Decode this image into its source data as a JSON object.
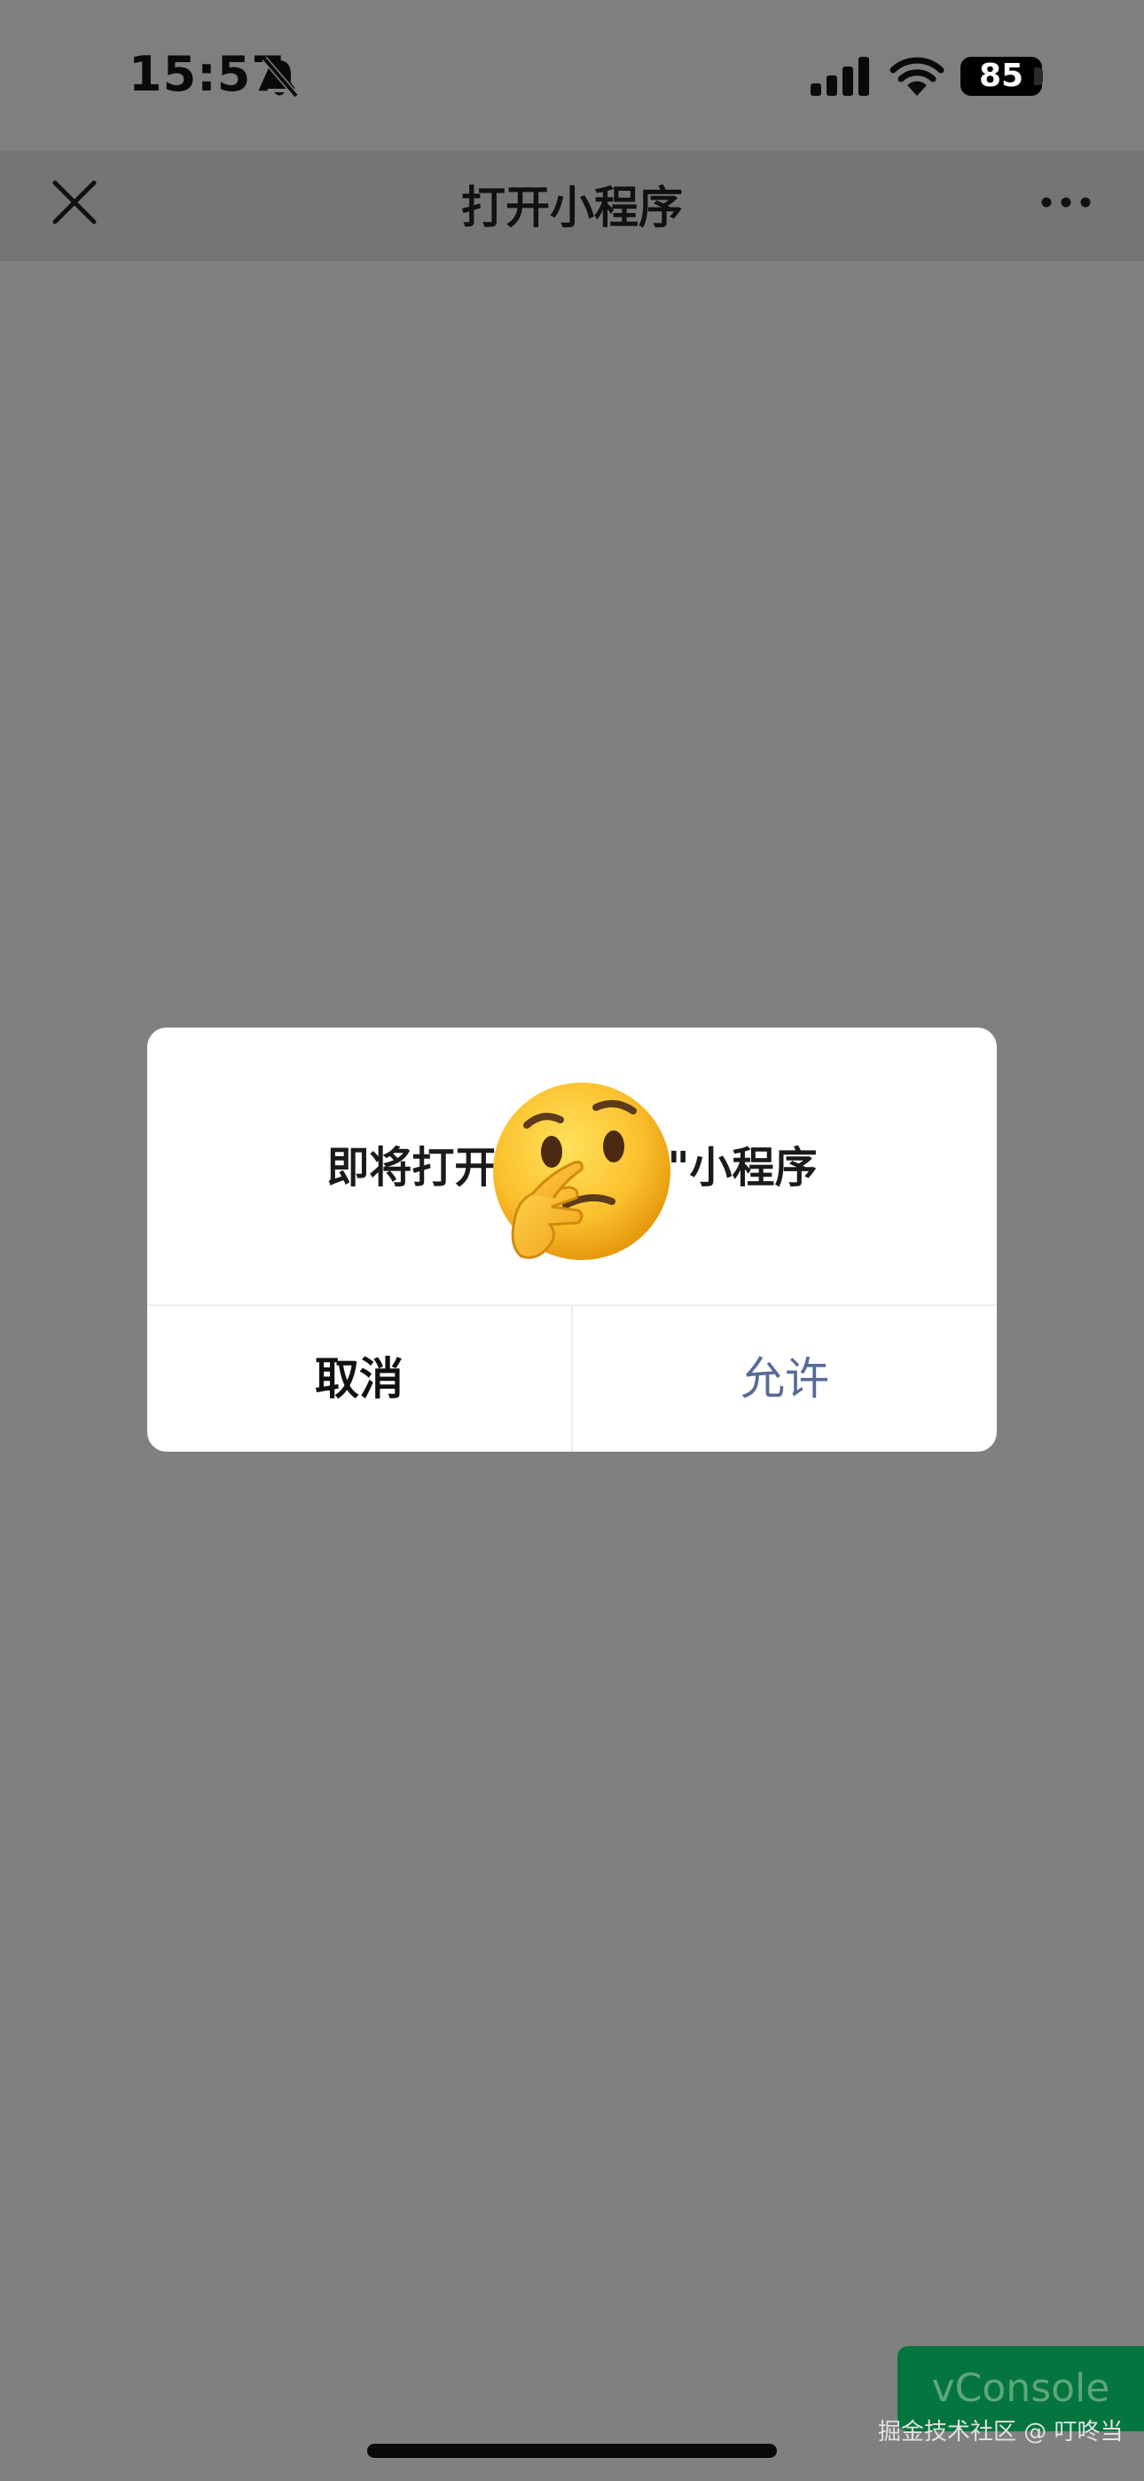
{
  "status_bar": {
    "time": "15:57",
    "battery": "85"
  },
  "nav": {
    "title": "打开小程序"
  },
  "dialog": {
    "message": "即将打开\"          \"小程序",
    "cancel_label": "取消",
    "allow_label": "允许"
  },
  "vconsole": {
    "label": "vConsole"
  },
  "watermark": "掘金技术社区 @ 叮咚当",
  "colors": {
    "overlay": "#808080",
    "allow_text": "#576b95",
    "vconsole_bg": "#04753f"
  }
}
